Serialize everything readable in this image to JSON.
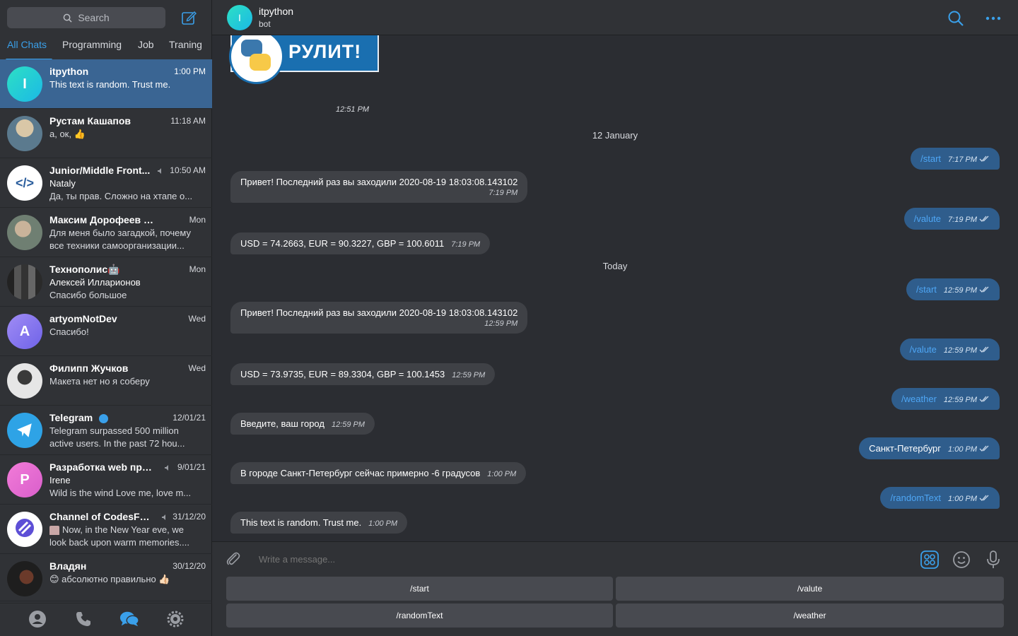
{
  "sidebar": {
    "search_label": "Search",
    "tabs": [
      {
        "label": "All Chats"
      },
      {
        "label": "Programming"
      },
      {
        "label": "Job"
      },
      {
        "label": "Traning"
      }
    ],
    "chats": [
      {
        "name": "itpython",
        "time": "1:00 PM",
        "line1": "This text is random. Trust me.",
        "line2": "",
        "avatar_letter": "I",
        "avatar_color": "#25d6c9"
      },
      {
        "name": "Рустам Кашапов",
        "time": "11:18 AM",
        "line1": "а, ок, 👍",
        "line2": "",
        "avatar_letter": "",
        "avatar_color": "#5b7a8e"
      },
      {
        "name": "Junior/Middle Front...",
        "time": "10:50 AM",
        "line1": "Nataly",
        "line2": "Да, ты прав. Сложно на хтапе о...",
        "avatar_letter": "</>",
        "avatar_color": "#ffffff"
      },
      {
        "name": "Максим Дорофеев и mno...",
        "time": "Mon",
        "line1": "Для меня было загадкой, почему",
        "line2": "все техники самоорганизации...",
        "avatar_letter": "",
        "avatar_color": "#6f7f72"
      },
      {
        "name": "Технополис🤖",
        "time": "Mon",
        "line1": "Алексей Илларионов",
        "line2": "Спасибо большое",
        "avatar_letter": "",
        "avatar_color": "#3b3a36"
      },
      {
        "name": "artyomNotDev",
        "time": "Wed",
        "line1": "Спасибо!",
        "line2": "",
        "avatar_letter": "A",
        "avatar_color": "#8d7cf0"
      },
      {
        "name": "Филипп Жучков",
        "time": "Wed",
        "line1": "Макета нет но я соберу",
        "line2": "",
        "avatar_letter": "",
        "avatar_color": "#cfcfcf"
      },
      {
        "name": "Telegram",
        "time": "12/01/21",
        "line1": "Telegram surpassed 500 million",
        "line2": "active users.    In the past 72 hou...",
        "avatar_letter": "",
        "avatar_color": "#2ea3e6"
      },
      {
        "name": "Разработка web при...",
        "time": "9/01/21",
        "line1": "Irene",
        "line2": "Wild is the wind  Love me, love m...",
        "avatar_letter": "P",
        "avatar_color": "#e76fd3"
      },
      {
        "name": "Channel of CodesFord",
        "time": "31/12/20",
        "line1": "Now, in the New Year eve, we",
        "line2": "look back upon warm memories....",
        "avatar_letter": "",
        "avatar_color": "#ffffff"
      },
      {
        "name": "Владян",
        "time": "30/12/20",
        "line1": "😊 абсолютно правильно 👍🏻",
        "line2": "",
        "avatar_letter": "",
        "avatar_color": "#2a2a2a"
      }
    ]
  },
  "header": {
    "avatar_letter": "I",
    "title": "itpython",
    "subtitle": "bot"
  },
  "banner": {
    "text": "РУЛИТ!",
    "time": "12:51 PM"
  },
  "separators": {
    "first": "12 January",
    "second": "Today"
  },
  "messages": [
    {
      "dir": "out",
      "text": "/start",
      "time": "7:17 PM",
      "cmd": true
    },
    {
      "dir": "in",
      "text": "Привет! Последний раз вы заходили 2020-08-19 18:03:08.143102",
      "time": "7:19 PM"
    },
    {
      "dir": "out",
      "text": "/valute",
      "time": "7:19 PM",
      "cmd": true
    },
    {
      "dir": "in",
      "text": "USD = 74.2663, EUR = 90.3227, GBP = 100.6011",
      "time": "7:19 PM"
    },
    {
      "dir": "out",
      "text": "/start",
      "time": "12:59 PM",
      "cmd": true
    },
    {
      "dir": "in",
      "text": "Привет! Последний раз вы заходили 2020-08-19 18:03:08.143102",
      "time": "12:59 PM"
    },
    {
      "dir": "out",
      "text": "/valute",
      "time": "12:59 PM",
      "cmd": true
    },
    {
      "dir": "in",
      "text": "USD = 73.9735, EUR = 89.3304, GBP = 100.1453",
      "time": "12:59 PM"
    },
    {
      "dir": "out",
      "text": "/weather",
      "time": "12:59 PM",
      "cmd": true
    },
    {
      "dir": "in",
      "text": "Введите, ваш город",
      "time": "12:59 PM"
    },
    {
      "dir": "out",
      "text": "Санкт-Петербург",
      "time": "1:00 PM",
      "cmd": false
    },
    {
      "dir": "in",
      "text": "В городе Санкт-Петербург сейчас примерно -6 градусов",
      "time": "1:00 PM"
    },
    {
      "dir": "out",
      "text": "/randomText",
      "time": "1:00 PM",
      "cmd": true
    },
    {
      "dir": "in",
      "text": "This text is random. Trust me.",
      "time": "1:00 PM"
    }
  ],
  "composer": {
    "placeholder": "Write a message..."
  },
  "keyboard": {
    "buttons": [
      "/start",
      "/valute",
      "/randomText",
      "/weather"
    ]
  },
  "colors": {
    "accent": "#3aa0ea",
    "active_chat": "#3a6593",
    "out_bubble": "#2f5d8c",
    "in_bubble": "#3f4146"
  }
}
